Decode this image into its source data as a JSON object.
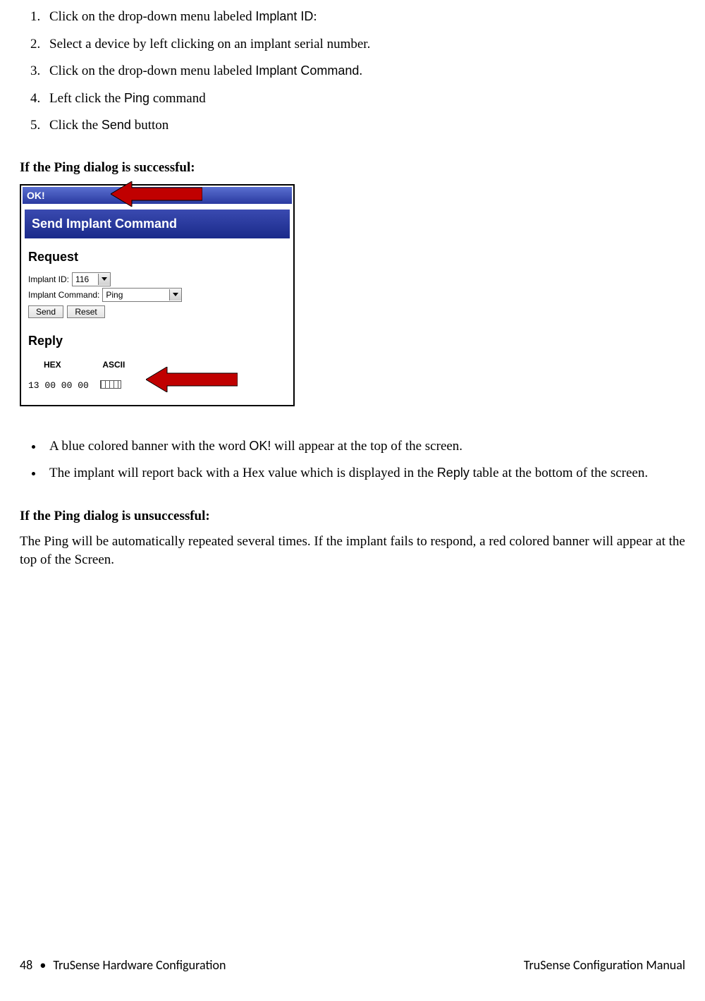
{
  "steps": [
    {
      "pre": "Click on the drop-down menu labeled ",
      "sans": "Implant ID",
      "post": ":"
    },
    {
      "pre": "Select a device by left clicking on an implant serial number.",
      "sans": "",
      "post": ""
    },
    {
      "pre": "Click on the drop-down menu labeled ",
      "sans": "Implant Command",
      "post": "."
    },
    {
      "pre": "Left click the ",
      "sans": "Ping",
      "post": " command"
    },
    {
      "pre": "Click the ",
      "sans": "Send",
      "post": " button"
    }
  ],
  "headings": {
    "success": "If the Ping dialog is successful:",
    "unsuccess": "If the Ping dialog is unsuccessful:"
  },
  "dialog": {
    "ok": "OK!",
    "send_title": "Send Implant Command",
    "request": "Request",
    "implant_id_label": "Implant ID:",
    "implant_id_value": "116",
    "implant_cmd_label": "Implant Command:",
    "implant_cmd_value": "Ping",
    "send_btn": "Send",
    "reset_btn": "Reset",
    "reply": "Reply",
    "hex_label": "HEX",
    "ascii_label": "ASCII",
    "hex_values": "13  00  00  00"
  },
  "bullets": [
    {
      "pre": "A blue colored banner with the word ",
      "sans": "OK!",
      "post": " will appear at the top of the screen."
    },
    {
      "pre": "The implant will report back with a Hex value which is displayed in the ",
      "sans": "Reply",
      "post": " table at the bottom of the screen."
    }
  ],
  "unsuccess_body": "The Ping will be automatically repeated several times. If the implant fails to respond, a red colored banner will appear at the top of the Screen.",
  "footer": {
    "page": "48",
    "bullet": "•",
    "left": "TruSense Hardware Configuration",
    "right": "TruSense Configuration Manual"
  }
}
